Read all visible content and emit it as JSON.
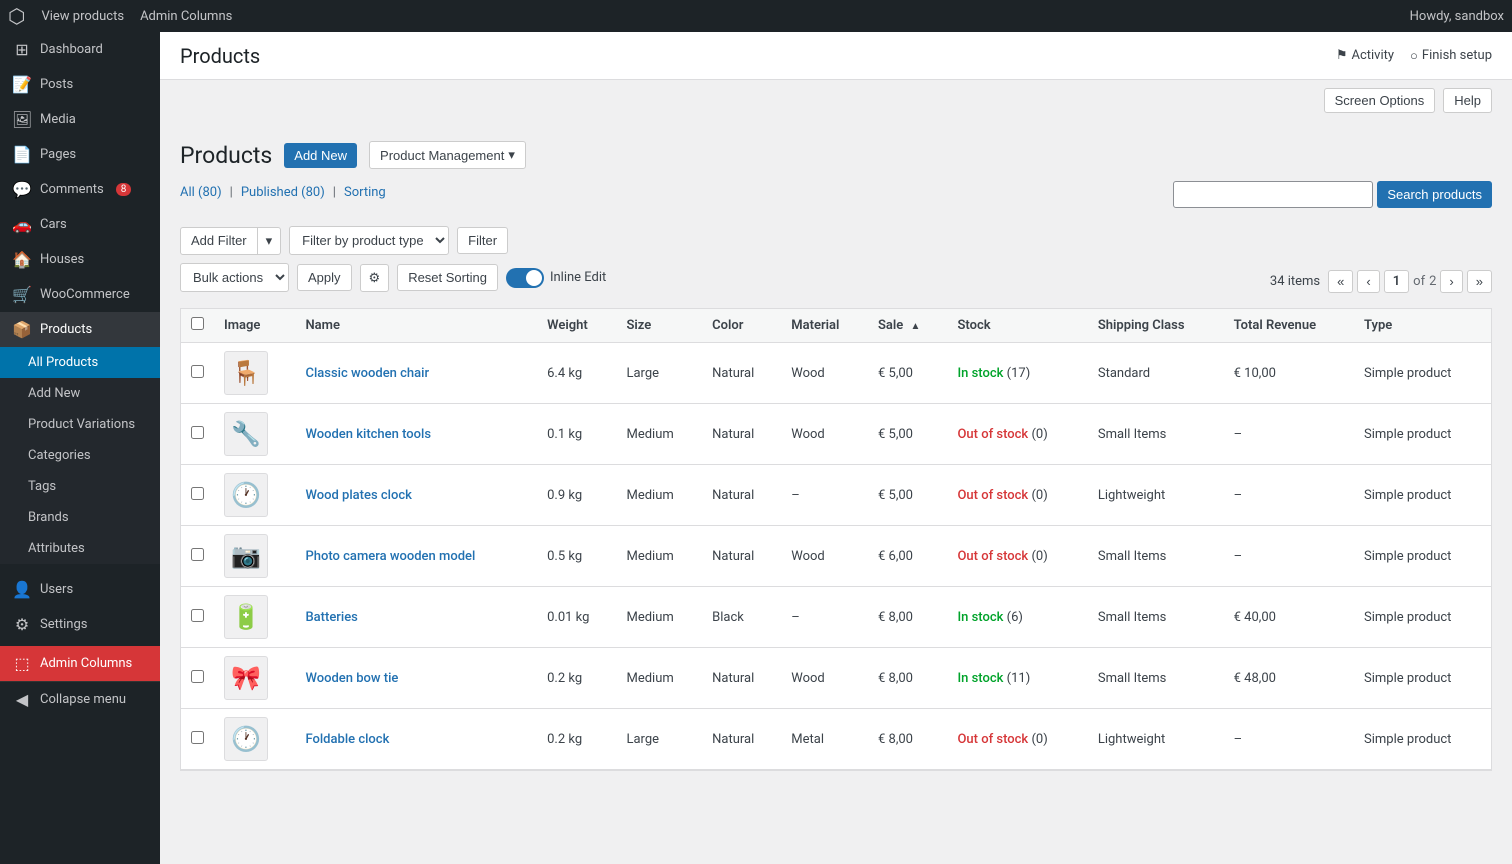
{
  "adminBar": {
    "logo": "W",
    "links": [
      "View products",
      "Admin Columns"
    ],
    "user": "Howdy, sandbox"
  },
  "sidebar": {
    "items": [
      {
        "id": "dashboard",
        "icon": "⊞",
        "label": "Dashboard"
      },
      {
        "id": "posts",
        "icon": "📝",
        "label": "Posts"
      },
      {
        "id": "media",
        "icon": "🖼",
        "label": "Media"
      },
      {
        "id": "pages",
        "icon": "📄",
        "label": "Pages"
      },
      {
        "id": "comments",
        "icon": "💬",
        "label": "Comments",
        "badge": "8"
      },
      {
        "id": "cars",
        "icon": "🚗",
        "label": "Cars"
      },
      {
        "id": "houses",
        "icon": "🏠",
        "label": "Houses"
      },
      {
        "id": "woocommerce",
        "icon": "🛒",
        "label": "WooCommerce"
      },
      {
        "id": "products",
        "icon": "📦",
        "label": "Products",
        "active": true
      },
      {
        "id": "users",
        "icon": "👤",
        "label": "Users"
      },
      {
        "id": "settings",
        "icon": "⚙",
        "label": "Settings"
      },
      {
        "id": "admin-columns",
        "icon": "⬚",
        "label": "Admin Columns",
        "highlight": true
      }
    ],
    "subMenu": [
      {
        "id": "all-products",
        "label": "All Products",
        "active": true
      },
      {
        "id": "add-new",
        "label": "Add New"
      },
      {
        "id": "product-variations",
        "label": "Product Variations"
      },
      {
        "id": "categories",
        "label": "Categories"
      },
      {
        "id": "tags",
        "label": "Tags"
      },
      {
        "id": "brands",
        "label": "Brands"
      },
      {
        "id": "attributes",
        "label": "Attributes"
      }
    ],
    "collapseLabel": "Collapse menu"
  },
  "header": {
    "title": "Products",
    "activityLabel": "Activity",
    "finishSetupLabel": "Finish setup"
  },
  "screenBar": {
    "screenOptionsLabel": "Screen Options",
    "helpLabel": "Help"
  },
  "page": {
    "title": "Products",
    "addNewLabel": "Add New",
    "productMgmtLabel": "Product Management",
    "filterLinks": {
      "all": "All",
      "allCount": "80",
      "published": "Published",
      "publishedCount": "80",
      "sorting": "Sorting"
    },
    "searchPlaceholder": "",
    "searchBtnLabel": "Search products",
    "filterRow": {
      "addFilterLabel": "Add Filter",
      "filterByProductTypeLabel": "Filter by product type",
      "filterBtnLabel": "Filter"
    },
    "bulkRow": {
      "bulkActionsLabel": "Bulk actions",
      "applyLabel": "Apply",
      "resetSortingLabel": "Reset Sorting",
      "inlineEditLabel": "Inline Edit"
    },
    "pagination": {
      "itemCount": "34 items",
      "currentPage": "1",
      "totalPages": "2",
      "firstLabel": "«",
      "prevLabel": "‹",
      "nextLabel": "›",
      "lastLabel": "»"
    },
    "table": {
      "columns": [
        {
          "id": "image",
          "label": "Image"
        },
        {
          "id": "name",
          "label": "Name"
        },
        {
          "id": "weight",
          "label": "Weight"
        },
        {
          "id": "size",
          "label": "Size"
        },
        {
          "id": "color",
          "label": "Color"
        },
        {
          "id": "material",
          "label": "Material"
        },
        {
          "id": "sale",
          "label": "Sale",
          "sorted": true,
          "sortDir": "asc"
        },
        {
          "id": "stock",
          "label": "Stock"
        },
        {
          "id": "shipping-class",
          "label": "Shipping Class"
        },
        {
          "id": "total-revenue",
          "label": "Total Revenue"
        },
        {
          "id": "type",
          "label": "Type"
        }
      ],
      "rows": [
        {
          "id": 1,
          "image": "🪑",
          "name": "Classic wooden chair",
          "weight": "6.4 kg",
          "size": "Large",
          "color": "Natural",
          "material": "Wood",
          "sale": "€ 5,00",
          "stockStatus": "In stock",
          "stockQty": "17",
          "shippingClass": "Standard",
          "totalRevenue": "€ 10,00",
          "type": "Simple product"
        },
        {
          "id": 2,
          "image": "🔧",
          "name": "Wooden kitchen tools",
          "weight": "0.1 kg",
          "size": "Medium",
          "color": "Natural",
          "material": "Wood",
          "sale": "€ 5,00",
          "stockStatus": "Out of stock",
          "stockQty": "0",
          "shippingClass": "Small Items",
          "totalRevenue": "–",
          "type": "Simple product"
        },
        {
          "id": 3,
          "image": "🕐",
          "name": "Wood plates clock",
          "weight": "0.9 kg",
          "size": "Medium",
          "color": "Natural",
          "material": "–",
          "sale": "€ 5,00",
          "stockStatus": "Out of stock",
          "stockQty": "0",
          "shippingClass": "Lightweight",
          "totalRevenue": "–",
          "type": "Simple product"
        },
        {
          "id": 4,
          "image": "📷",
          "name": "Photo camera wooden model",
          "weight": "0.5 kg",
          "size": "Medium",
          "color": "Natural",
          "material": "Wood",
          "sale": "€ 6,00",
          "stockStatus": "Out of stock",
          "stockQty": "0",
          "shippingClass": "Small Items",
          "totalRevenue": "–",
          "type": "Simple product"
        },
        {
          "id": 5,
          "image": "🔋",
          "name": "Batteries",
          "weight": "0.01 kg",
          "size": "Medium",
          "color": "Black",
          "material": "–",
          "sale": "€ 8,00",
          "stockStatus": "In stock",
          "stockQty": "6",
          "shippingClass": "Small Items",
          "totalRevenue": "€ 40,00",
          "type": "Simple product"
        },
        {
          "id": 6,
          "image": "🎀",
          "name": "Wooden bow tie",
          "weight": "0.2 kg",
          "size": "Medium",
          "color": "Natural",
          "material": "Wood",
          "sale": "€ 8,00",
          "stockStatus": "In stock",
          "stockQty": "11",
          "shippingClass": "Small Items",
          "totalRevenue": "€ 48,00",
          "type": "Simple product"
        },
        {
          "id": 7,
          "image": "🕐",
          "name": "Foldable clock",
          "weight": "0.2 kg",
          "size": "Large",
          "color": "Natural",
          "material": "Metal",
          "sale": "€ 8,00",
          "stockStatus": "Out of stock",
          "stockQty": "0",
          "shippingClass": "Lightweight",
          "totalRevenue": "–",
          "type": "Simple product"
        }
      ]
    }
  },
  "colors": {
    "inStock": "#00a32a",
    "outStock": "#d63638",
    "accent": "#2271b1",
    "adminBg": "#1d2327",
    "activeHighlight": "#d63638"
  }
}
